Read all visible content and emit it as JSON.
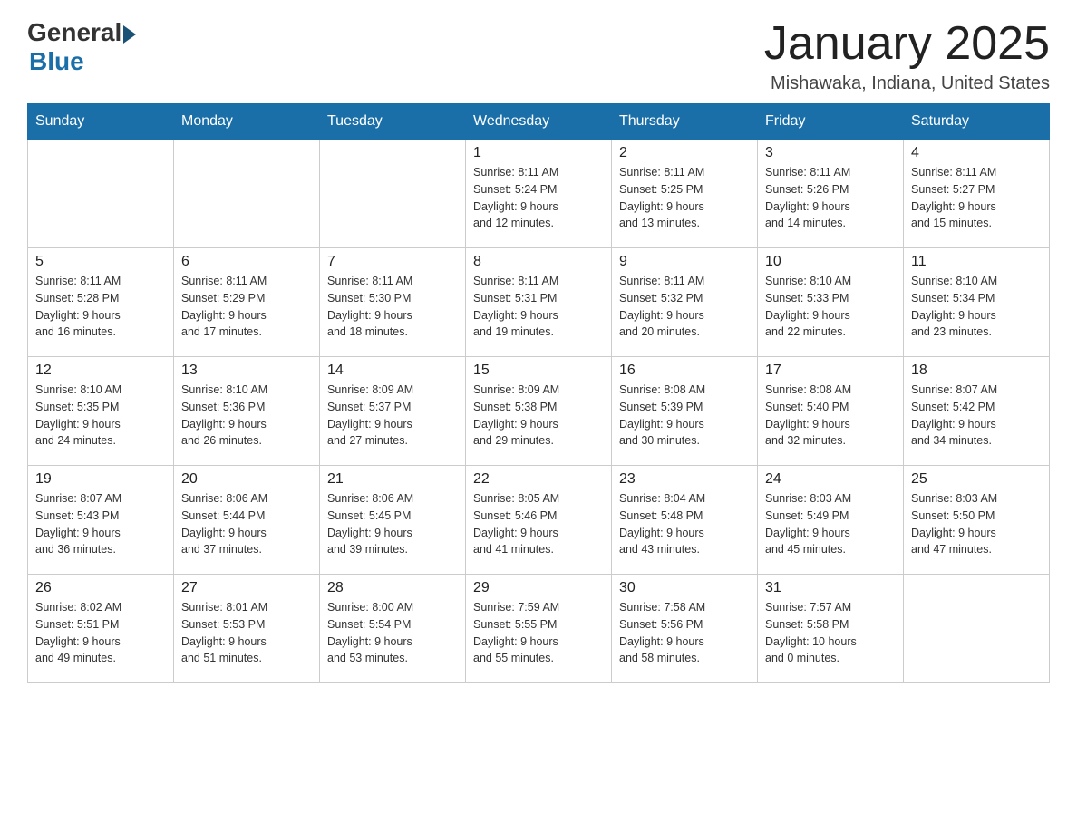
{
  "header": {
    "logo_general": "General",
    "logo_blue": "Blue",
    "title": "January 2025",
    "subtitle": "Mishawaka, Indiana, United States"
  },
  "calendar": {
    "days_of_week": [
      "Sunday",
      "Monday",
      "Tuesday",
      "Wednesday",
      "Thursday",
      "Friday",
      "Saturday"
    ],
    "weeks": [
      [
        {
          "day": "",
          "info": ""
        },
        {
          "day": "",
          "info": ""
        },
        {
          "day": "",
          "info": ""
        },
        {
          "day": "1",
          "info": "Sunrise: 8:11 AM\nSunset: 5:24 PM\nDaylight: 9 hours\nand 12 minutes."
        },
        {
          "day": "2",
          "info": "Sunrise: 8:11 AM\nSunset: 5:25 PM\nDaylight: 9 hours\nand 13 minutes."
        },
        {
          "day": "3",
          "info": "Sunrise: 8:11 AM\nSunset: 5:26 PM\nDaylight: 9 hours\nand 14 minutes."
        },
        {
          "day": "4",
          "info": "Sunrise: 8:11 AM\nSunset: 5:27 PM\nDaylight: 9 hours\nand 15 minutes."
        }
      ],
      [
        {
          "day": "5",
          "info": "Sunrise: 8:11 AM\nSunset: 5:28 PM\nDaylight: 9 hours\nand 16 minutes."
        },
        {
          "day": "6",
          "info": "Sunrise: 8:11 AM\nSunset: 5:29 PM\nDaylight: 9 hours\nand 17 minutes."
        },
        {
          "day": "7",
          "info": "Sunrise: 8:11 AM\nSunset: 5:30 PM\nDaylight: 9 hours\nand 18 minutes."
        },
        {
          "day": "8",
          "info": "Sunrise: 8:11 AM\nSunset: 5:31 PM\nDaylight: 9 hours\nand 19 minutes."
        },
        {
          "day": "9",
          "info": "Sunrise: 8:11 AM\nSunset: 5:32 PM\nDaylight: 9 hours\nand 20 minutes."
        },
        {
          "day": "10",
          "info": "Sunrise: 8:10 AM\nSunset: 5:33 PM\nDaylight: 9 hours\nand 22 minutes."
        },
        {
          "day": "11",
          "info": "Sunrise: 8:10 AM\nSunset: 5:34 PM\nDaylight: 9 hours\nand 23 minutes."
        }
      ],
      [
        {
          "day": "12",
          "info": "Sunrise: 8:10 AM\nSunset: 5:35 PM\nDaylight: 9 hours\nand 24 minutes."
        },
        {
          "day": "13",
          "info": "Sunrise: 8:10 AM\nSunset: 5:36 PM\nDaylight: 9 hours\nand 26 minutes."
        },
        {
          "day": "14",
          "info": "Sunrise: 8:09 AM\nSunset: 5:37 PM\nDaylight: 9 hours\nand 27 minutes."
        },
        {
          "day": "15",
          "info": "Sunrise: 8:09 AM\nSunset: 5:38 PM\nDaylight: 9 hours\nand 29 minutes."
        },
        {
          "day": "16",
          "info": "Sunrise: 8:08 AM\nSunset: 5:39 PM\nDaylight: 9 hours\nand 30 minutes."
        },
        {
          "day": "17",
          "info": "Sunrise: 8:08 AM\nSunset: 5:40 PM\nDaylight: 9 hours\nand 32 minutes."
        },
        {
          "day": "18",
          "info": "Sunrise: 8:07 AM\nSunset: 5:42 PM\nDaylight: 9 hours\nand 34 minutes."
        }
      ],
      [
        {
          "day": "19",
          "info": "Sunrise: 8:07 AM\nSunset: 5:43 PM\nDaylight: 9 hours\nand 36 minutes."
        },
        {
          "day": "20",
          "info": "Sunrise: 8:06 AM\nSunset: 5:44 PM\nDaylight: 9 hours\nand 37 minutes."
        },
        {
          "day": "21",
          "info": "Sunrise: 8:06 AM\nSunset: 5:45 PM\nDaylight: 9 hours\nand 39 minutes."
        },
        {
          "day": "22",
          "info": "Sunrise: 8:05 AM\nSunset: 5:46 PM\nDaylight: 9 hours\nand 41 minutes."
        },
        {
          "day": "23",
          "info": "Sunrise: 8:04 AM\nSunset: 5:48 PM\nDaylight: 9 hours\nand 43 minutes."
        },
        {
          "day": "24",
          "info": "Sunrise: 8:03 AM\nSunset: 5:49 PM\nDaylight: 9 hours\nand 45 minutes."
        },
        {
          "day": "25",
          "info": "Sunrise: 8:03 AM\nSunset: 5:50 PM\nDaylight: 9 hours\nand 47 minutes."
        }
      ],
      [
        {
          "day": "26",
          "info": "Sunrise: 8:02 AM\nSunset: 5:51 PM\nDaylight: 9 hours\nand 49 minutes."
        },
        {
          "day": "27",
          "info": "Sunrise: 8:01 AM\nSunset: 5:53 PM\nDaylight: 9 hours\nand 51 minutes."
        },
        {
          "day": "28",
          "info": "Sunrise: 8:00 AM\nSunset: 5:54 PM\nDaylight: 9 hours\nand 53 minutes."
        },
        {
          "day": "29",
          "info": "Sunrise: 7:59 AM\nSunset: 5:55 PM\nDaylight: 9 hours\nand 55 minutes."
        },
        {
          "day": "30",
          "info": "Sunrise: 7:58 AM\nSunset: 5:56 PM\nDaylight: 9 hours\nand 58 minutes."
        },
        {
          "day": "31",
          "info": "Sunrise: 7:57 AM\nSunset: 5:58 PM\nDaylight: 10 hours\nand 0 minutes."
        },
        {
          "day": "",
          "info": ""
        }
      ]
    ]
  }
}
